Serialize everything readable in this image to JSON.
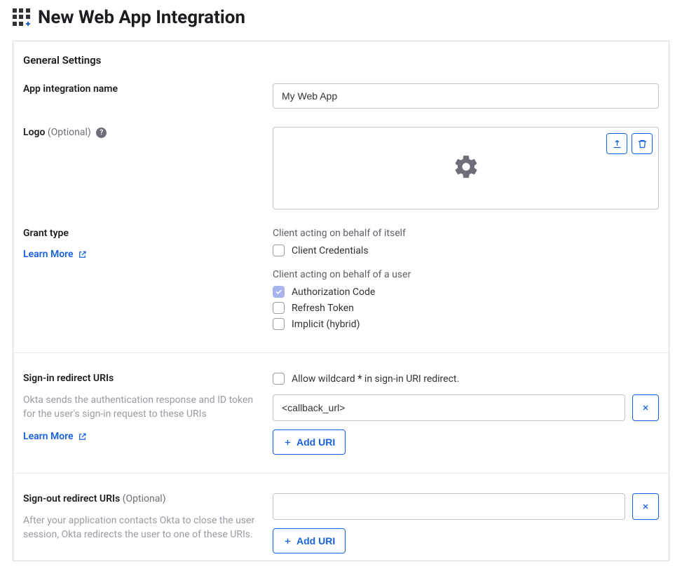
{
  "header": {
    "title": "New Web App Integration"
  },
  "panel": {
    "section_title": "General Settings"
  },
  "app_name": {
    "label": "App integration name",
    "value": "My Web App"
  },
  "logo": {
    "label": "Logo",
    "optional": "(Optional)"
  },
  "grant": {
    "label": "Grant type",
    "learn_more": "Learn More",
    "self_heading": "Client acting on behalf of itself",
    "client_credentials": "Client Credentials",
    "user_heading": "Client acting on behalf of a user",
    "auth_code": "Authorization Code",
    "refresh_token": "Refresh Token",
    "implicit": "Implicit (hybrid)"
  },
  "signin": {
    "label": "Sign-in redirect URIs",
    "helptext": "Okta sends the authentication response and ID token for the user's sign-in request to these URIs",
    "learn_more": "Learn More",
    "wildcard_prefix": "Allow wildcard ",
    "wildcard_star": "*",
    "wildcard_suffix": " in sign-in URI redirect.",
    "uri_value": "<callback_url>",
    "add_uri": "Add URI"
  },
  "signout": {
    "label": "Sign-out redirect URIs",
    "optional": "(Optional)",
    "helptext": "After your application contacts Okta to close the user session, Okta redirects the user to one of these URIs.",
    "uri_value": "",
    "add_uri": "Add URI"
  }
}
